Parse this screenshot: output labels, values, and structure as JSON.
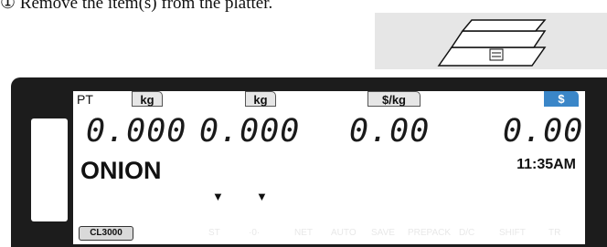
{
  "instruction": "① Remove the item(s) from the platter.",
  "display": {
    "labels": {
      "pt": "PT",
      "kg1": "kg",
      "kg2": "kg",
      "per_kg": "$/kg",
      "dollar": "$"
    },
    "readouts": {
      "tare": "0.000",
      "weight": "0.000",
      "unit_price": "0.00",
      "total": "0.00"
    },
    "item_name": "ONION",
    "time": "11:35AM",
    "markers": [
      "▼",
      "▼"
    ],
    "model_badge": "CL3000",
    "indicators": [
      "ST",
      "·0·",
      "NET",
      "AUTO",
      "SAVE",
      "PREPACK",
      "D/C",
      "SHIFT",
      "TR"
    ]
  }
}
